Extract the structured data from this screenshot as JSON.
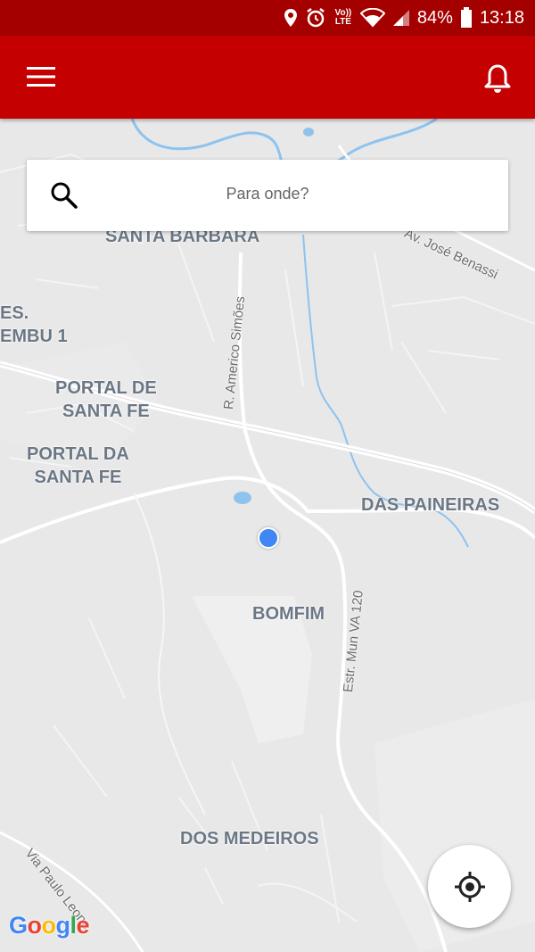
{
  "status_bar": {
    "battery": "84%",
    "time": "13:18",
    "network": "Vo)) LTE",
    "icons": [
      "location-pin-icon",
      "alarm-icon",
      "volte-icon",
      "wifi-icon",
      "signal-icon",
      "battery-icon"
    ]
  },
  "app_bar": {
    "color": "#c40000",
    "menu_icon": "hamburger-menu-icon",
    "notification_icon": "bell-icon"
  },
  "search": {
    "placeholder": "Para onde?",
    "icon": "search-icon"
  },
  "map": {
    "areas": [
      {
        "id": "santa-barbara",
        "text": "SANTA BARBARA"
      },
      {
        "id": "res-embu",
        "text": "ES.\nEMBU 1"
      },
      {
        "id": "portal-de-santa-fe",
        "text": "PORTAL DE\nSANTA FE"
      },
      {
        "id": "portal-da-santa-fe",
        "text": "PORTAL DA\nSANTA FE"
      },
      {
        "id": "das-paineiras",
        "text": "DAS PAINEIRAS"
      },
      {
        "id": "bomfim",
        "text": "BOMFIM"
      },
      {
        "id": "dos-medeiros",
        "text": "DOS MEDEIROS"
      }
    ],
    "streets": [
      {
        "id": "r-americo-simoes",
        "text": "R. Americo Simões"
      },
      {
        "id": "av-jose-benassi",
        "text": "Av. José Benassi"
      },
      {
        "id": "estr-mun",
        "text": "Estr. Mun VA 120"
      },
      {
        "id": "via-paulo-leone",
        "text": "Via Paulo Leone"
      }
    ],
    "attribution": "Google",
    "attribution_colors": [
      "#4285f4",
      "#ea4335",
      "#fbbc05",
      "#4285f4",
      "#34a853",
      "#ea4335"
    ],
    "current_location_color": "#4285f4"
  },
  "locate_button": {
    "icon": "my-location-icon"
  }
}
